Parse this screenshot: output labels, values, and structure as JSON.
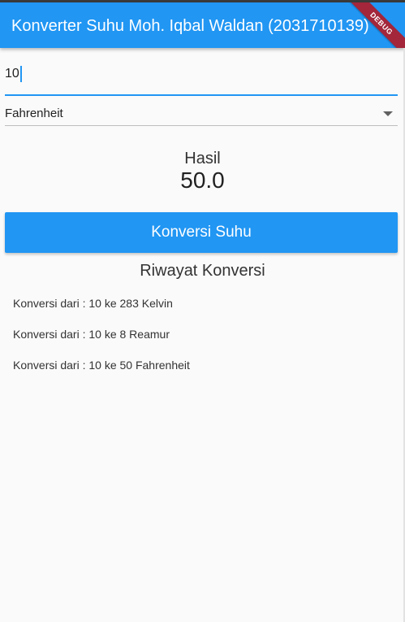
{
  "app_bar": {
    "title": "Konverter Suhu Moh. Iqbal Waldan (2031710139)",
    "debug_banner": "DEBUG",
    "color": "#2196f3"
  },
  "input": {
    "value": "10"
  },
  "dropdown": {
    "selected": "Fahrenheit",
    "icon": "arrow-drop-down-icon"
  },
  "result": {
    "label": "Hasil",
    "value": "50.0"
  },
  "convert_button": {
    "label": "Konversi Suhu"
  },
  "history": {
    "title": "Riwayat Konversi",
    "items": [
      "Konversi dari : 10 ke 283 Kelvin",
      "Konversi dari : 10 ke 8 Reamur",
      "Konversi dari : 10 ke 50 Fahrenheit"
    ]
  }
}
